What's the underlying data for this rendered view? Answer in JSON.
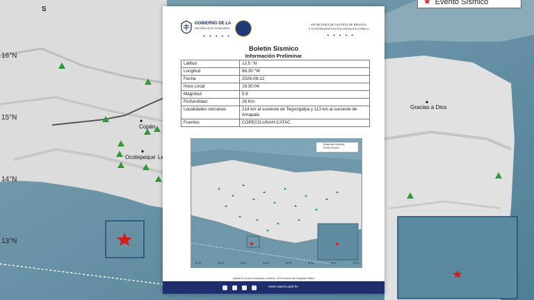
{
  "map": {
    "lat_labels": [
      "16°N",
      "15°N",
      "14°N",
      "13°N"
    ],
    "north_marker": "S",
    "places": [
      "Copán",
      "Ocotepeque",
      "Le",
      "Gracias a Dios"
    ],
    "legend_label": "Evento Sísmico",
    "accent_colors": {
      "star": "#d21d1d",
      "station": "#2e9a3a",
      "inset": "#1e4f78",
      "footer": "#1e2e6d"
    }
  },
  "doc": {
    "gov_name": "GOBIERNO DE LA",
    "gov_sub": "REPÚBLICA DE HONDURAS",
    "gov_stars": "★ ★ ★ ★ ★",
    "sec_line1": "SECRETARÍA DE GESTIÓN DE RIESGOS",
    "sec_line2": "Y CONTINGENCIAS NACIONALES COPECO",
    "sec_stars": "★ ★ ★ ★ ★",
    "title": "Boletín Sísmico",
    "subtitle": "Información Preliminar",
    "rows": [
      {
        "k": "Latitud",
        "v": "12.5 °N"
      },
      {
        "k": "Longitud",
        "v": "88.30 °W"
      },
      {
        "k": "Fecha",
        "v": "2026-08-12"
      },
      {
        "k": "Hora Local",
        "v": "18:30:04"
      },
      {
        "k": "Magnitud",
        "v": "5.8"
      },
      {
        "k": "Profundidad",
        "v": "28 Km"
      },
      {
        "k": "Localidades cercanas",
        "v": "214 km al suroeste de Tegucigalpa y 113 km al suroeste de Amapala"
      },
      {
        "k": "Fuentes",
        "v": "COPECO-UNAH-CATAC"
      }
    ],
    "minimap_legend": [
      "Estaciones Sísmicas",
      "Evento Sísmico"
    ],
    "minimap_axis": [
      "87°W",
      "86°W",
      "85°W",
      "84°W",
      "83°W",
      "82°W",
      "81°W",
      "80°W"
    ],
    "footer_address": "Aldea El Ocotal Carretera a Mateo, 300 metros del Hospital Militar",
    "footer_web": "www.copeco.gob.hn",
    "social_icons": [
      "facebook-icon",
      "x-icon",
      "instagram-icon",
      "youtube-icon"
    ]
  }
}
